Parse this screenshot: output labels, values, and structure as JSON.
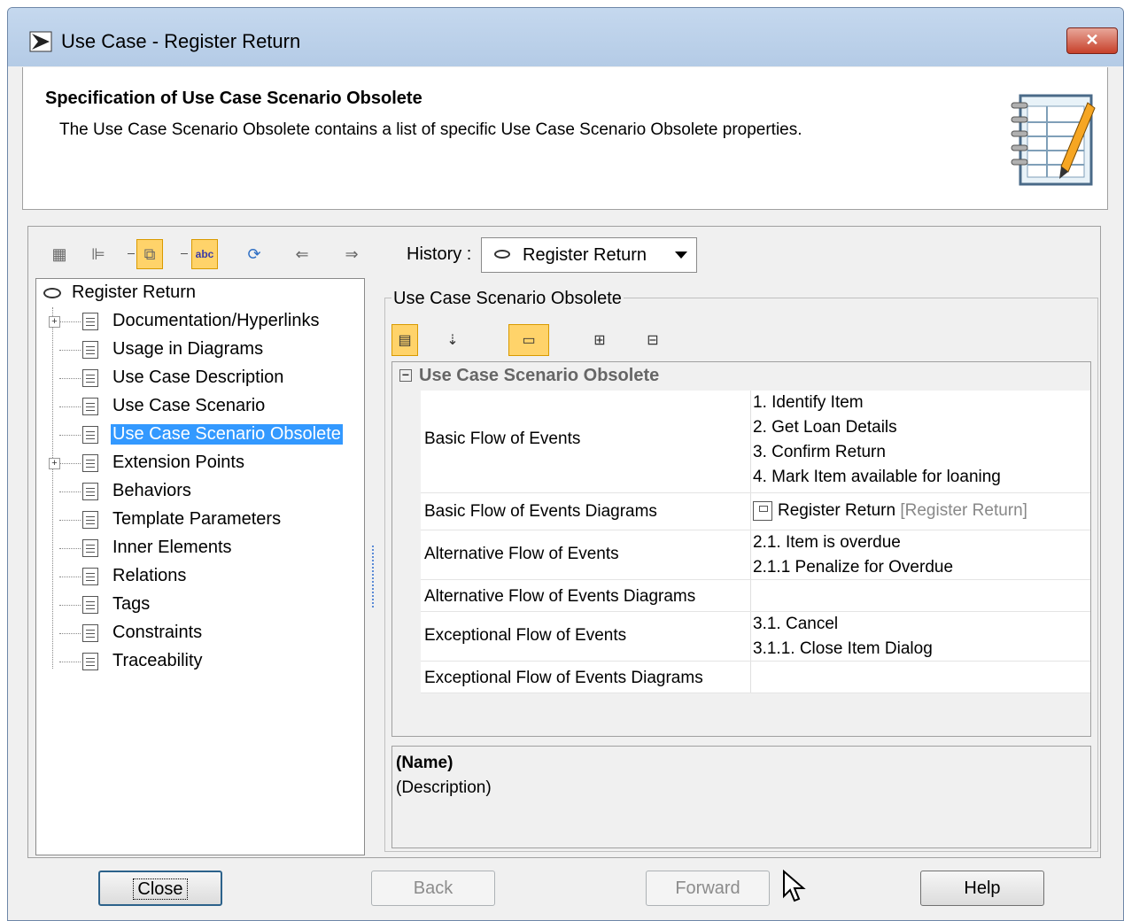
{
  "window": {
    "title": "Use Case - Register Return",
    "close_symbol": "✕"
  },
  "header": {
    "title": "Specification of Use Case Scenario Obsolete",
    "description": "The Use Case Scenario Obsolete contains a list of specific Use Case Scenario Obsolete properties."
  },
  "toolbar": {
    "icons": [
      "properties-icon",
      "tree-icon",
      "compact-icon",
      "abc-icon",
      "refresh-icon",
      "back-arrow-icon",
      "forward-arrow-icon"
    ],
    "history_label": "History :",
    "history_value": "Register Return"
  },
  "tree": {
    "root": "Register Return",
    "items": [
      {
        "label": "Documentation/Hyperlinks",
        "expandable": true
      },
      {
        "label": "Usage in Diagrams"
      },
      {
        "label": "Use Case Description"
      },
      {
        "label": "Use Case Scenario"
      },
      {
        "label": "Use Case Scenario Obsolete",
        "selected": true
      },
      {
        "label": "Extension Points",
        "expandable": true
      },
      {
        "label": "Behaviors"
      },
      {
        "label": "Template Parameters"
      },
      {
        "label": "Inner Elements"
      },
      {
        "label": "Relations"
      },
      {
        "label": "Tags"
      },
      {
        "label": "Constraints"
      },
      {
        "label": "Traceability"
      }
    ]
  },
  "panel": {
    "group_title": "Use Case Scenario Obsolete",
    "section_title": "Use Case Scenario Obsolete",
    "rows": [
      {
        "key": "Basic Flow of Events",
        "values": [
          "1. Identify Item",
          "2. Get Loan Details",
          "3. Confirm Return",
          "4. Mark Item available for loaning"
        ]
      },
      {
        "key": "Basic Flow of Events Diagrams",
        "diagram": "Register Return",
        "diagram_owner": "[Register Return]"
      },
      {
        "key": "Alternative Flow of Events",
        "values": [
          "2.1. Item is overdue",
          "2.1.1 Penalize for Overdue"
        ]
      },
      {
        "key": "Alternative Flow of Events Diagrams",
        "values": []
      },
      {
        "key": "Exceptional Flow of Events",
        "values": [
          "3.1. Cancel",
          "3.1.1. Close Item Dialog"
        ]
      },
      {
        "key": "Exceptional Flow of Events Diagrams",
        "values": []
      }
    ],
    "name_label": "(Name)",
    "description_label": "(Description)"
  },
  "buttons": {
    "close": "Close",
    "back": "Back",
    "forward": "Forward",
    "help": "Help"
  }
}
